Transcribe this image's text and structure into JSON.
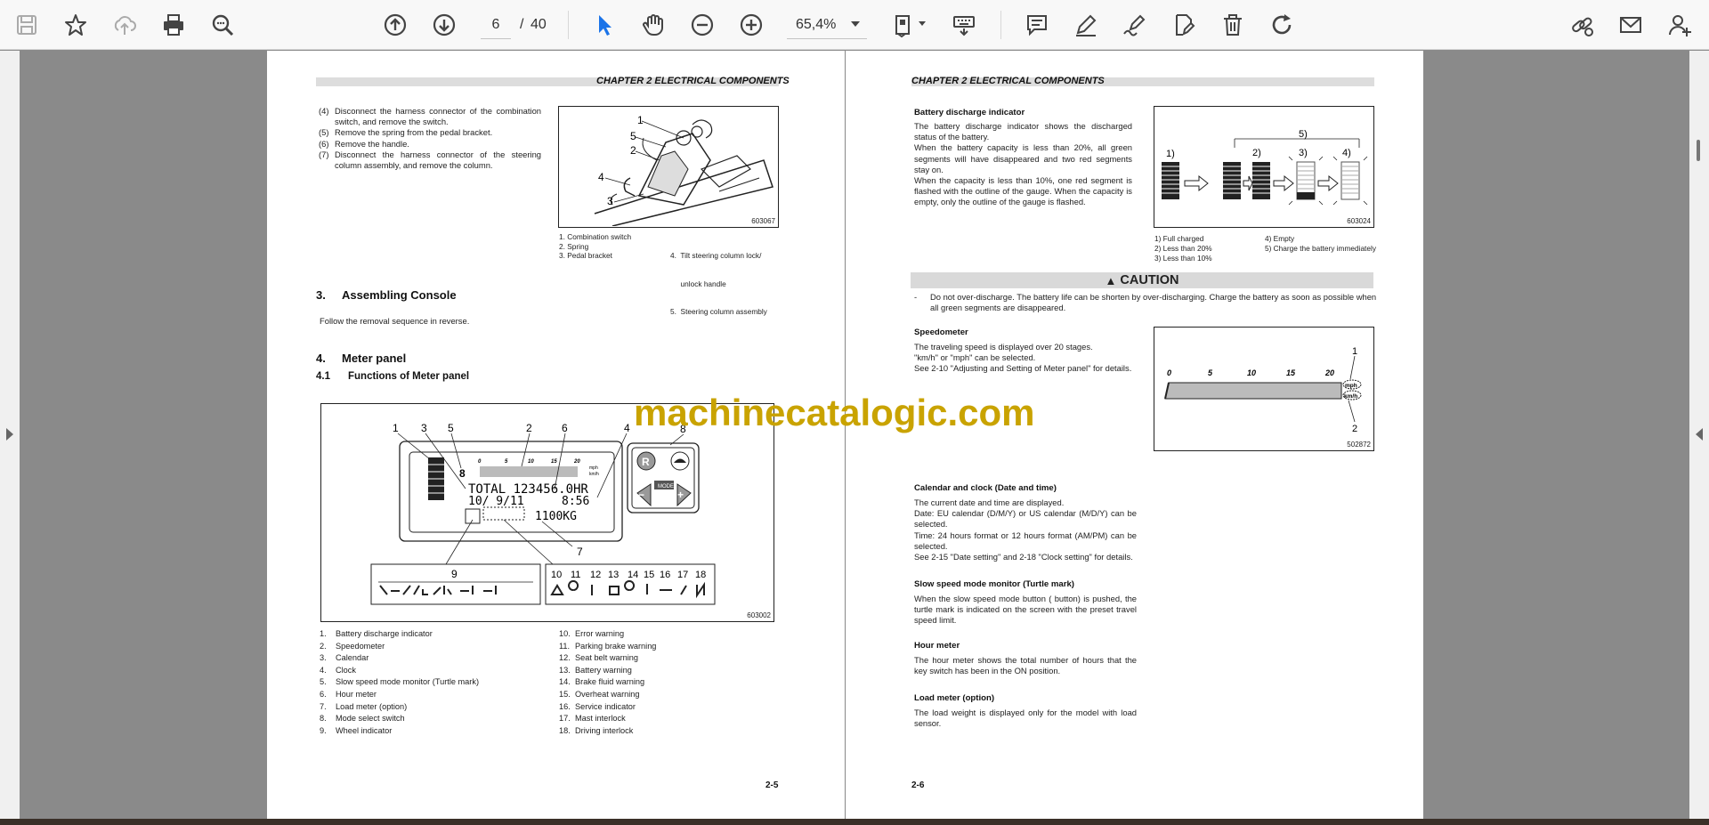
{
  "toolbar": {
    "page_current": "6",
    "page_sep": "/",
    "page_total": "40",
    "zoom": "65,4%"
  },
  "colors": {
    "watermark": "#c9a300",
    "accent": "#1a73e8"
  },
  "left_page": {
    "header": "CHAPTER 2 ELECTRICAL COMPONENTS",
    "steps": [
      {
        "n": "(4)",
        "text": "Disconnect the harness connector of the combination switch, and remove the switch."
      },
      {
        "n": "(5)",
        "text": "Remove the spring from the pedal bracket."
      },
      {
        "n": "(6)",
        "text": "Remove the handle."
      },
      {
        "n": "(7)",
        "text": "Disconnect the harness connector of the steering column assembly, and remove the column."
      }
    ],
    "fig1": {
      "code": "603067",
      "callouts": [
        "1",
        "5",
        "2",
        "4",
        "3"
      ],
      "legend_left": [
        "1.  Combination switch",
        "2.  Spring",
        "3.  Pedal bracket"
      ],
      "legend_right": [
        "4.  Tilt steering column lock/",
        "     unlock handle",
        "5.  Steering column assembly"
      ]
    },
    "section3": {
      "num": "3.",
      "title": "Assembling Console",
      "body": "Follow the removal sequence in reverse."
    },
    "section4": {
      "num": "4.",
      "title": "Meter panel"
    },
    "section41": {
      "num": "4.1",
      "title": "Functions of Meter panel"
    },
    "fig2": {
      "code": "603002",
      "top_callouts": [
        "1",
        "3",
        "5",
        "2",
        "6",
        "4",
        "8"
      ],
      "lcd_total": "TOTAL 123456.0HR",
      "lcd_date": "10/ 9/11",
      "lcd_time": "8:56",
      "lcd_load": "1100KG",
      "lcd_scale": [
        "0",
        "5",
        "10",
        "15",
        "20"
      ],
      "lcd_unit1": "mph",
      "lcd_unit2": "km/h",
      "lcd_digit": "8",
      "btn_r": "R",
      "btn_minus": "−",
      "btn_plus": "+",
      "btn_mode": "MODE",
      "callout7": "7",
      "callout9": "9",
      "bottom_callouts": [
        "10",
        "11",
        "12",
        "13",
        "14",
        "15",
        "16",
        "17",
        "18"
      ]
    },
    "legend_left": [
      "1.",
      "Battery discharge indicator",
      "2.",
      "Speedometer",
      "3.",
      "Calendar",
      "4.",
      "Clock",
      "5.",
      "Slow speed mode monitor (Turtle mark)",
      "6.",
      "Hour meter",
      "7.",
      "Load meter (option)",
      "8.",
      "Mode select switch",
      "9.",
      "Wheel indicator"
    ],
    "legend_right": [
      "10.",
      "Error warning",
      "11.",
      "Parking brake warning",
      "12.",
      "Seat belt warning",
      "13.",
      "Battery warning",
      "14.",
      "Brake fluid warning",
      "15.",
      "Overheat warning",
      "16.",
      "Service indicator",
      "17.",
      "Mast interlock",
      "18.",
      "Driving interlock"
    ],
    "page_number": "2-5"
  },
  "right_page": {
    "header": "CHAPTER 2 ELECTRICAL COMPONENTS",
    "battery": {
      "title": "Battery discharge indicator",
      "body": [
        "The battery discharge indicator shows the discharged status of the battery.",
        "When the battery capacity is less than 20%, all green segments will have disappeared and two red segments stay on.",
        "When the capacity is less than 10%, one red segment is flashed with the outline of the gauge. When the capacity is empty, only the outline of the gauge is flashed."
      ],
      "fig_code": "603024",
      "fig_labels": [
        "1)",
        "2)",
        "3)",
        "4)",
        "5)"
      ],
      "legend_left": [
        "1) Full charged",
        "2) Less than 20%",
        "3) Less than 10%"
      ],
      "legend_right": [
        "4) Empty",
        "5) Charge the battery immediately"
      ]
    },
    "caution": {
      "label": "CAUTION",
      "dash": "-",
      "text": "Do not over-discharge. The battery life can be shorten by over-discharging. Charge the battery as soon as possible when all green segments are disappeared."
    },
    "speedometer": {
      "title": "Speedometer",
      "body": [
        "The traveling speed is displayed over 20 stages.",
        "\"km/h\" or \"mph\" can be selected.",
        "See 2-10 \"Adjusting and Setting of Meter panel\" for details."
      ],
      "fig_code": "502872",
      "scale": [
        "0",
        "5",
        "10",
        "15",
        "20"
      ],
      "callouts": [
        "1",
        "2"
      ],
      "unit1": "mph",
      "unit2": "km/h"
    },
    "calendar": {
      "title": "Calendar and clock (Date and time)",
      "body": [
        "The current date and time are displayed.",
        "Date: EU calendar (D/M/Y) or US calendar (M/D/Y) can be selected.",
        "Time: 24 hours format or 12 hours format (AM/PM) can be selected.",
        "See 2-15 \"Date setting\" and 2-18 \"Clock setting\" for details."
      ]
    },
    "slow": {
      "title": "Slow speed mode monitor (Turtle mark)",
      "body": "When the slow speed mode button (   button) is pushed, the turtle mark is indicated on the screen with the preset travel speed limit."
    },
    "hour": {
      "title": "Hour meter",
      "body": "The hour meter shows the total number of hours that the key switch has been in the ON position."
    },
    "load": {
      "title": "Load meter (option)",
      "body": "The load weight is displayed only for the model with load sensor."
    },
    "page_number": "2-6"
  },
  "watermark": "machinecatalogic.com"
}
